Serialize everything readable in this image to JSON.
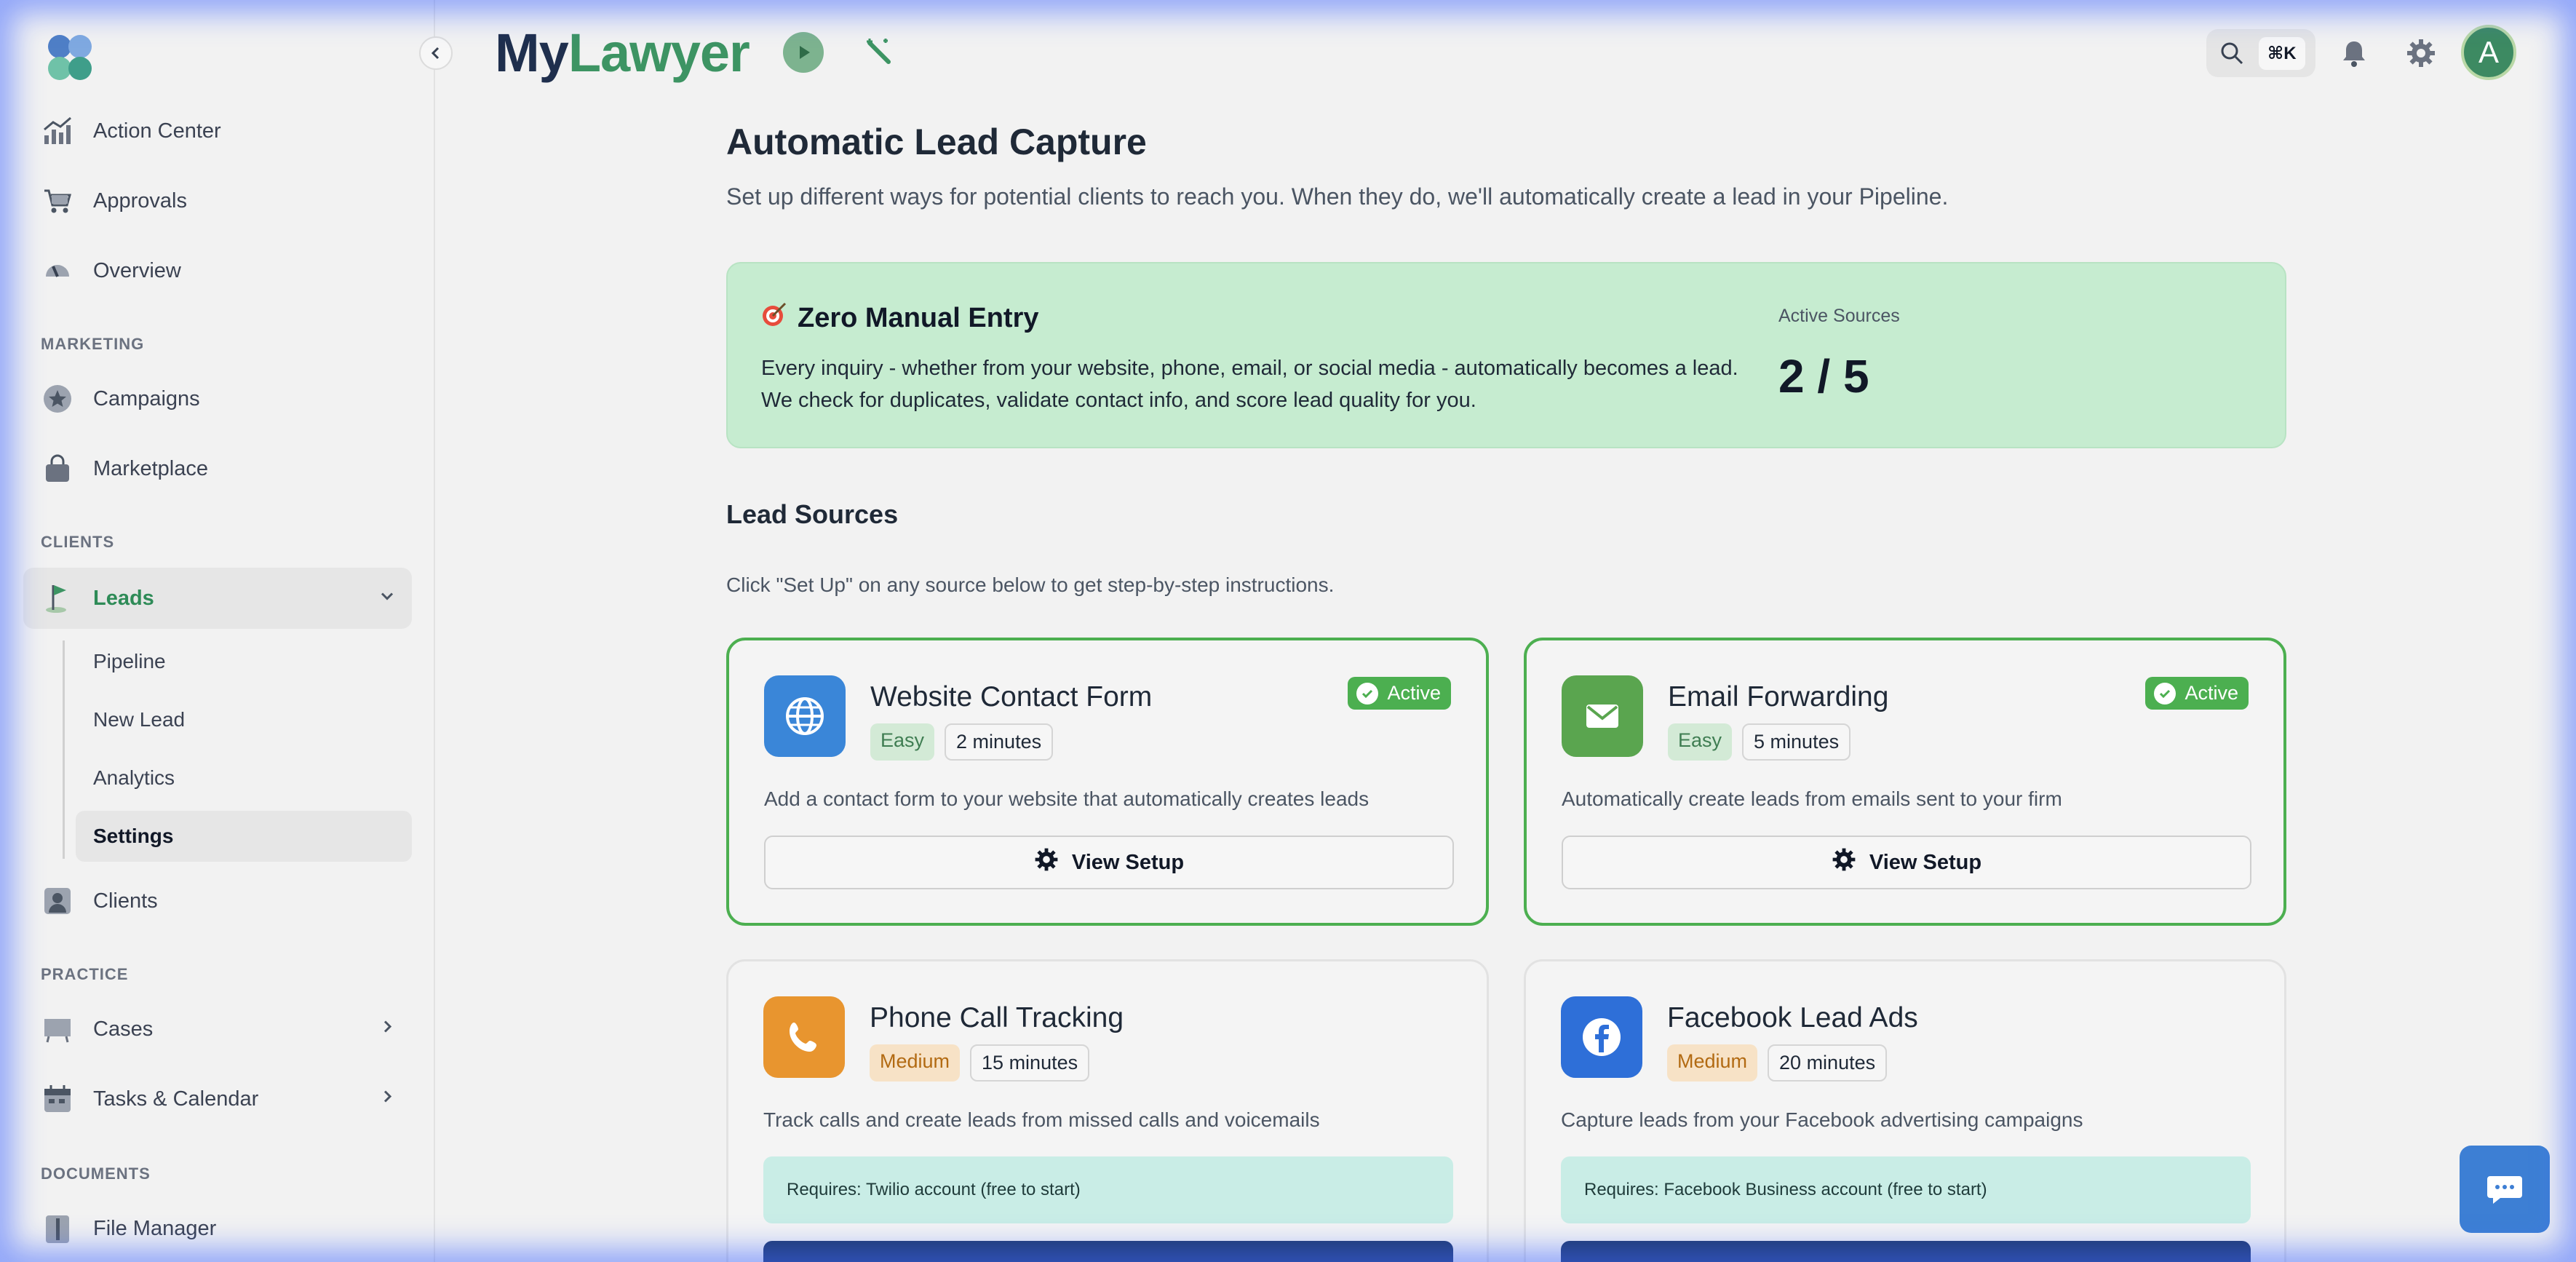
{
  "brand": {
    "part1": "My",
    "part2": "Lawyer"
  },
  "sidebar": {
    "items": {
      "action_center": "Action Center",
      "approvals": "Approvals",
      "overview": "Overview",
      "campaigns": "Campaigns",
      "marketplace": "Marketplace",
      "leads": "Leads",
      "clients": "Clients",
      "cases": "Cases",
      "tasks_calendar": "Tasks & Calendar",
      "file_manager": "File Manager"
    },
    "sections": {
      "marketing": "MARKETING",
      "clients": "CLIENTS",
      "practice": "PRACTICE",
      "documents": "DOCUMENTS"
    },
    "leads_sub": {
      "pipeline": "Pipeline",
      "new_lead": "New Lead",
      "analytics": "Analytics",
      "settings": "Settings"
    }
  },
  "header": {
    "search_shortcut": "⌘K",
    "avatar_initial": "A"
  },
  "main": {
    "title": "Automatic Lead Capture",
    "subtitle": "Set up different ways for potential clients to reach you. When they do, we'll automatically create a lead in your Pipeline.",
    "hero": {
      "title": "Zero Manual Entry",
      "desc_line1": "Every inquiry - whether from your website, phone, email, or social media - automatically becomes a lead.",
      "desc_line2": "We check for duplicates, validate contact info, and score lead quality for you.",
      "stat_label": "Active Sources",
      "stat_value": "2 / 5"
    },
    "sources_title": "Lead Sources",
    "sources_hint": "Click \"Set Up\" on any source below to get step-by-step instructions.",
    "cards": [
      {
        "title": "Website Contact Form",
        "difficulty": "Easy",
        "time": "2 minutes",
        "status": "Active",
        "desc": "Add a contact form to your website that automatically creates leads",
        "button": "View Setup"
      },
      {
        "title": "Email Forwarding",
        "difficulty": "Easy",
        "time": "5 minutes",
        "status": "Active",
        "desc": "Automatically create leads from emails sent to your firm",
        "button": "View Setup"
      },
      {
        "title": "Phone Call Tracking",
        "difficulty": "Medium",
        "time": "15 minutes",
        "desc": "Track calls and create leads from missed calls and voicemails",
        "requires": "Requires: Twilio account (free to start)"
      },
      {
        "title": "Facebook Lead Ads",
        "difficulty": "Medium",
        "time": "20 minutes",
        "desc": "Capture leads from your Facebook advertising campaigns",
        "requires": "Requires: Facebook Business account (free to start)"
      }
    ]
  },
  "colors": {
    "brand_dark": "#1f2f4d",
    "brand_green": "#3d9463",
    "active_green": "#4caf50",
    "hero_bg": "#c6ecd0",
    "website_icon": "#3a86d8",
    "email_icon": "#5aa54f",
    "phone_icon": "#e8952f",
    "facebook_icon": "#2e6fd8"
  },
  "icons": {
    "logo": "clover-logo-icon",
    "action_center": "chart-trend-icon",
    "approvals": "cart-icon",
    "overview": "gauge-icon",
    "campaigns": "star-badge-icon",
    "marketplace": "shopping-bag-icon",
    "leads": "flag-icon",
    "clients": "user-card-icon",
    "cases": "board-icon",
    "tasks_calendar": "calendar-icon",
    "file_manager": "folder-icon",
    "search": "search-icon",
    "notifications": "bell-icon",
    "settings": "gear-icon",
    "play": "play-icon",
    "wand": "magic-wand-icon",
    "chat": "chat-icon"
  }
}
